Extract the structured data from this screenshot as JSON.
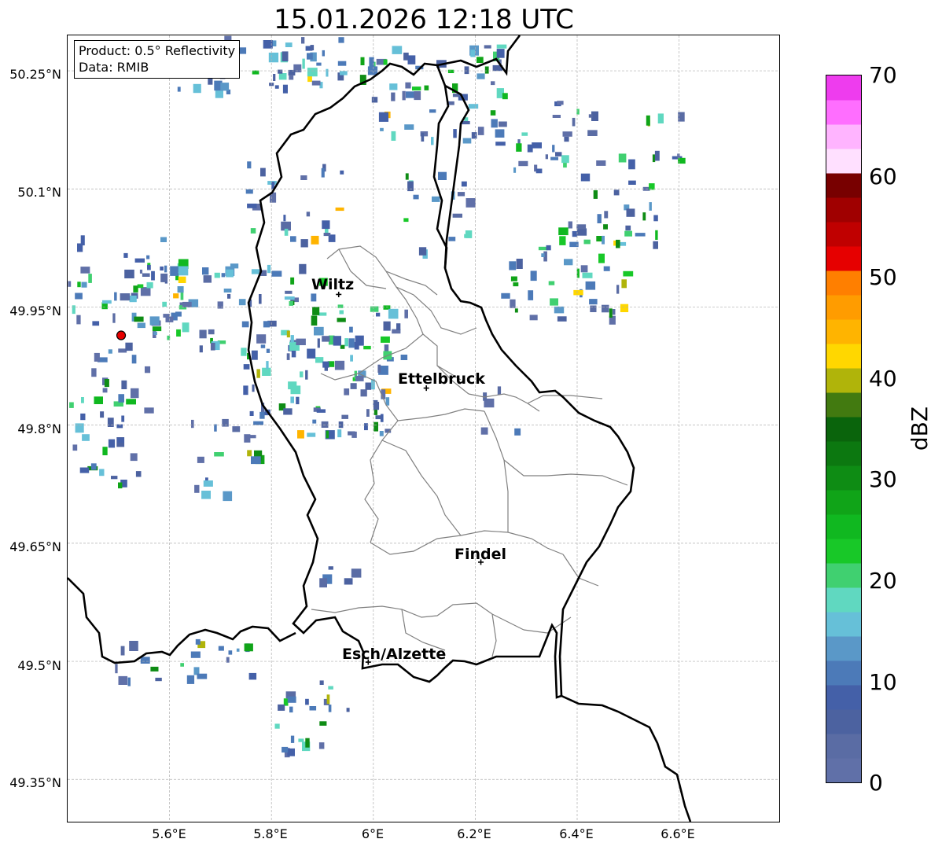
{
  "title": "15.01.2026 12:18 UTC",
  "info": {
    "product": "Product: 0.5° Reflectivity",
    "data_source": "Data: RMIB"
  },
  "axes": {
    "lat_ticks": [
      "50.25°N",
      "50.1°N",
      "49.95°N",
      "49.8°N",
      "49.65°N",
      "49.5°N",
      "49.35°N"
    ],
    "lon_ticks": [
      "5.6°E",
      "5.8°E",
      "6°E",
      "6.2°E",
      "6.4°E",
      "6.6°E"
    ],
    "lat_values": [
      50.25,
      50.1,
      49.95,
      49.8,
      49.65,
      49.5,
      49.35
    ],
    "lon_values": [
      5.6,
      5.8,
      6.0,
      6.2,
      6.4,
      6.6
    ],
    "gridlines": true,
    "gridline_style": "dashed-grey"
  },
  "cities": [
    {
      "name": "Wiltz",
      "lon": 5.932,
      "lat": 49.966
    },
    {
      "name": "Ettelbruck",
      "lon": 6.104,
      "lat": 49.847
    },
    {
      "name": "Findel",
      "lon": 6.211,
      "lat": 49.626
    },
    {
      "name": "Esch/Alzette",
      "lon": 5.99,
      "lat": 49.499
    }
  ],
  "radar_site": {
    "lon": 5.505,
    "lat": 49.914,
    "color": "#e60000"
  },
  "colorbar": {
    "label": "dBZ",
    "min": 0,
    "max": 70,
    "step": 2.5,
    "tick_labels": [
      "70",
      "60",
      "50",
      "40",
      "30",
      "20",
      "10",
      "0"
    ],
    "colors": [
      "#6070a8",
      "#5a6ca4",
      "#4c62a0",
      "#4460a8",
      "#4c7ab8",
      "#5a98c8",
      "#66c0d8",
      "#60d8c0",
      "#40d070",
      "#18c828",
      "#10b820",
      "#10a418",
      "#0e8c14",
      "#0c7810",
      "#0a640c",
      "#427a10",
      "#b0b40a",
      "#ffd700",
      "#ffb400",
      "#ff9c00",
      "#ff7f00",
      "#e60000",
      "#c00000",
      "#a00000",
      "#780000",
      "#ffe0ff",
      "#ffb4ff",
      "#ff6eff",
      "#ee3cee"
    ]
  },
  "colors": {
    "border_national": "#000000",
    "border_cantonal": "#808080",
    "grid": "#b0b0b0"
  }
}
